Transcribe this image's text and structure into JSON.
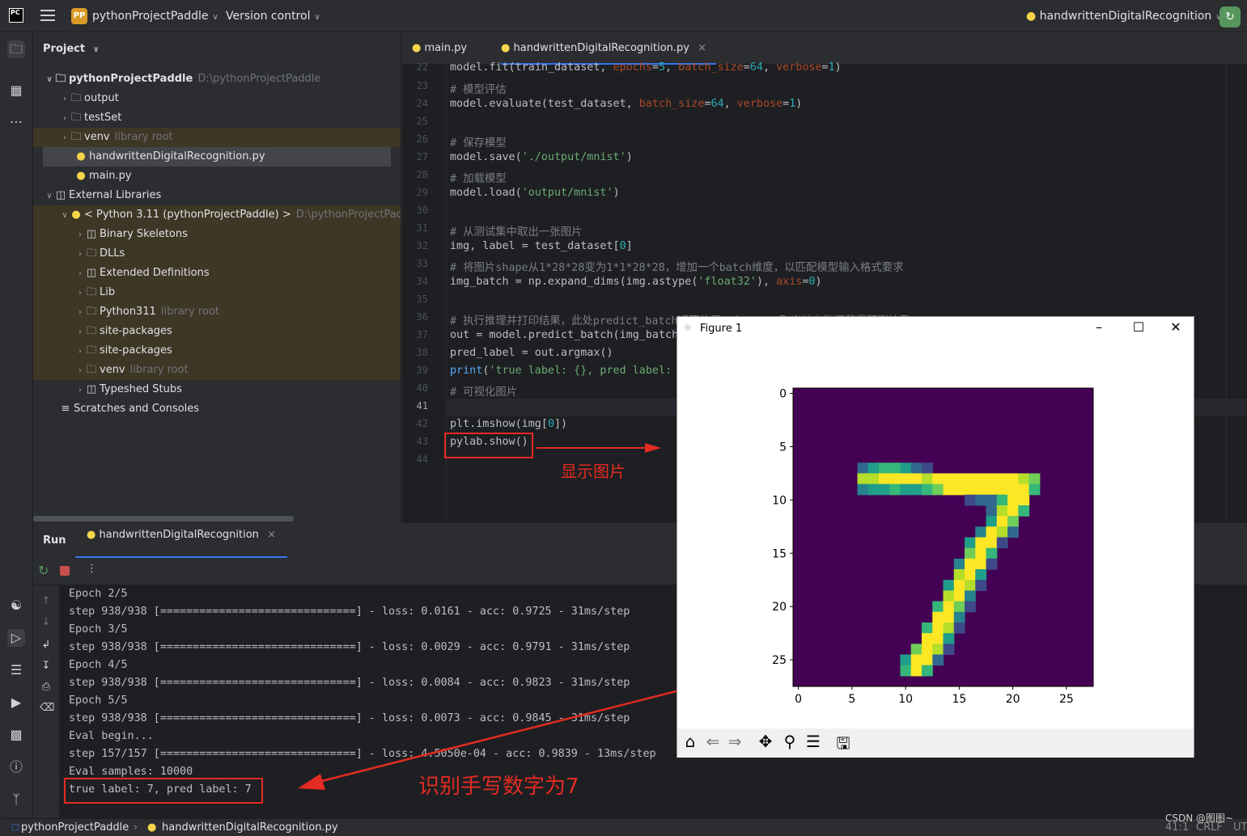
{
  "topbar": {
    "logo_text": "PC",
    "project_badge": "PP",
    "project_name": "pythonProjectPaddle",
    "vcs_label": "Version control",
    "run_config": "handwrittenDigitalRecognition"
  },
  "project_panel": {
    "title": "Project",
    "rows": [
      {
        "label": "pythonProjectPaddle",
        "hint": "D:\\pythonProjectPaddle"
      },
      {
        "label": "output",
        "hint": ""
      },
      {
        "label": "testSet",
        "hint": ""
      },
      {
        "label": "venv",
        "hint": "library root"
      },
      {
        "label": "handwrittenDigitalRecognition.py",
        "hint": ""
      },
      {
        "label": "main.py",
        "hint": ""
      },
      {
        "label": "External Libraries",
        "hint": ""
      },
      {
        "label": "< Python 3.11 (pythonProjectPaddle) >",
        "hint": "D:\\pythonProjectPadd"
      },
      {
        "label": "Binary Skeletons",
        "hint": ""
      },
      {
        "label": "DLLs",
        "hint": ""
      },
      {
        "label": "Extended Definitions",
        "hint": ""
      },
      {
        "label": "Lib",
        "hint": ""
      },
      {
        "label": "Python311",
        "hint": "library root"
      },
      {
        "label": "site-packages",
        "hint": ""
      },
      {
        "label": "site-packages",
        "hint": ""
      },
      {
        "label": "venv",
        "hint": "library root"
      },
      {
        "label": "Typeshed Stubs",
        "hint": ""
      },
      {
        "label": "Scratches and Consoles",
        "hint": ""
      }
    ]
  },
  "editor": {
    "tabs": [
      "main.py",
      "handwrittenDigitalRecognition.py"
    ],
    "line_numbers": [
      "22",
      "23",
      "24",
      "25",
      "26",
      "27",
      "28",
      "29",
      "30",
      "31",
      "32",
      "33",
      "34",
      "35",
      "36",
      "37",
      "38",
      "39",
      "40",
      "41",
      "42",
      "43",
      "44"
    ],
    "annotation_show": "显示图片"
  },
  "run_panel": {
    "title": "Run",
    "tab": "handwrittenDigitalRecognition",
    "lines": [
      "Epoch 2/5",
      "step 938/938 [==============================] - loss: 0.0161 - acc: 0.9725 - 31ms/step",
      "Epoch 3/5",
      "step 938/938 [==============================] - loss: 0.0029 - acc: 0.9791 - 31ms/step",
      "Epoch 4/5",
      "step 938/938 [==============================] - loss: 0.0084 - acc: 0.9823 - 31ms/step",
      "Epoch 5/5",
      "step 938/938 [==============================] - loss: 0.0073 - acc: 0.9845 - 31ms/step",
      "Eval begin...",
      "step 157/157 [==============================] - loss: 4.5050e-04 - acc: 0.9839 - 13ms/step",
      "Eval samples: 10000",
      "true label: 7, pred label: 7"
    ],
    "annotation_result": "识别手写数字为7"
  },
  "figure": {
    "title": "Figure 1",
    "y_ticks": [
      "0",
      "5",
      "10",
      "15",
      "20",
      "25"
    ],
    "x_ticks": [
      "0",
      "5",
      "10",
      "15",
      "20",
      "25"
    ]
  },
  "status": {
    "project": "pythonProjectPaddle",
    "file": "handwrittenDigitalRecognition.py",
    "position": "41:1",
    "line_sep": "CRLF",
    "encoding": "UT",
    "watermark": "CSDN @图图~"
  }
}
